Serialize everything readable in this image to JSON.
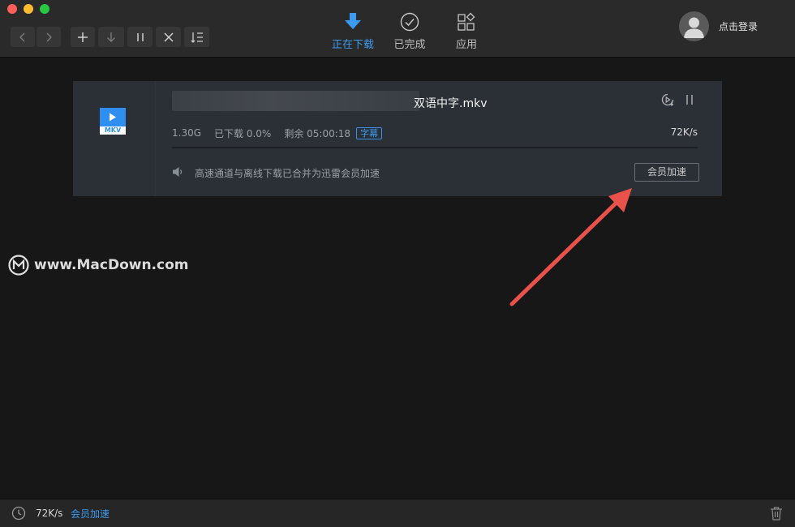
{
  "toolbar": {
    "back_icon": "chevron-left-icon",
    "forward_icon": "chevron-right-icon",
    "add_icon": "plus-icon",
    "download_icon": "arrow-down-icon",
    "pause_icon": "pause-icon",
    "delete_icon": "close-icon",
    "sort_icon": "sort-list-icon"
  },
  "tabs": [
    {
      "label": "正在下载",
      "icon": "download-arrow-icon",
      "active": true
    },
    {
      "label": "已完成",
      "icon": "check-circle-icon",
      "active": false
    },
    {
      "label": "应用",
      "icon": "apps-icon",
      "active": false
    }
  ],
  "user": {
    "login_label": "点击登录"
  },
  "download": {
    "file_name": "双语中字.mkv",
    "file_ext": "MKV",
    "size": "1.30G",
    "downloaded": "已下载 0.0%",
    "remaining": "剩余 05:00:18",
    "subtitle_badge": "字幕",
    "speed": "72K/s",
    "progress": 0.0,
    "notice": "高速通道与离线下载已合并为迅雷会员加速",
    "vip_button": "会员加速"
  },
  "watermark": {
    "text": "www.MacDown.com"
  },
  "statusbar": {
    "speed": "72K/s",
    "vip_link": "会员加速"
  },
  "colors": {
    "accent": "#3a9bf0",
    "arrow": "#e8524a"
  }
}
